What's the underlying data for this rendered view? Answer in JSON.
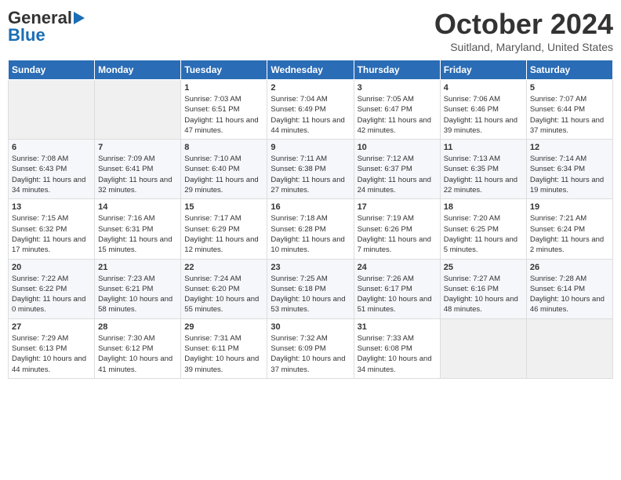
{
  "logo": {
    "line1": "General",
    "line2": "Blue"
  },
  "header": {
    "month": "October 2024",
    "location": "Suitland, Maryland, United States"
  },
  "days_of_week": [
    "Sunday",
    "Monday",
    "Tuesday",
    "Wednesday",
    "Thursday",
    "Friday",
    "Saturday"
  ],
  "weeks": [
    [
      {
        "day": "",
        "sunrise": "",
        "sunset": "",
        "daylight": ""
      },
      {
        "day": "",
        "sunrise": "",
        "sunset": "",
        "daylight": ""
      },
      {
        "day": "1",
        "sunrise": "Sunrise: 7:03 AM",
        "sunset": "Sunset: 6:51 PM",
        "daylight": "Daylight: 11 hours and 47 minutes."
      },
      {
        "day": "2",
        "sunrise": "Sunrise: 7:04 AM",
        "sunset": "Sunset: 6:49 PM",
        "daylight": "Daylight: 11 hours and 44 minutes."
      },
      {
        "day": "3",
        "sunrise": "Sunrise: 7:05 AM",
        "sunset": "Sunset: 6:47 PM",
        "daylight": "Daylight: 11 hours and 42 minutes."
      },
      {
        "day": "4",
        "sunrise": "Sunrise: 7:06 AM",
        "sunset": "Sunset: 6:46 PM",
        "daylight": "Daylight: 11 hours and 39 minutes."
      },
      {
        "day": "5",
        "sunrise": "Sunrise: 7:07 AM",
        "sunset": "Sunset: 6:44 PM",
        "daylight": "Daylight: 11 hours and 37 minutes."
      }
    ],
    [
      {
        "day": "6",
        "sunrise": "Sunrise: 7:08 AM",
        "sunset": "Sunset: 6:43 PM",
        "daylight": "Daylight: 11 hours and 34 minutes."
      },
      {
        "day": "7",
        "sunrise": "Sunrise: 7:09 AM",
        "sunset": "Sunset: 6:41 PM",
        "daylight": "Daylight: 11 hours and 32 minutes."
      },
      {
        "day": "8",
        "sunrise": "Sunrise: 7:10 AM",
        "sunset": "Sunset: 6:40 PM",
        "daylight": "Daylight: 11 hours and 29 minutes."
      },
      {
        "day": "9",
        "sunrise": "Sunrise: 7:11 AM",
        "sunset": "Sunset: 6:38 PM",
        "daylight": "Daylight: 11 hours and 27 minutes."
      },
      {
        "day": "10",
        "sunrise": "Sunrise: 7:12 AM",
        "sunset": "Sunset: 6:37 PM",
        "daylight": "Daylight: 11 hours and 24 minutes."
      },
      {
        "day": "11",
        "sunrise": "Sunrise: 7:13 AM",
        "sunset": "Sunset: 6:35 PM",
        "daylight": "Daylight: 11 hours and 22 minutes."
      },
      {
        "day": "12",
        "sunrise": "Sunrise: 7:14 AM",
        "sunset": "Sunset: 6:34 PM",
        "daylight": "Daylight: 11 hours and 19 minutes."
      }
    ],
    [
      {
        "day": "13",
        "sunrise": "Sunrise: 7:15 AM",
        "sunset": "Sunset: 6:32 PM",
        "daylight": "Daylight: 11 hours and 17 minutes."
      },
      {
        "day": "14",
        "sunrise": "Sunrise: 7:16 AM",
        "sunset": "Sunset: 6:31 PM",
        "daylight": "Daylight: 11 hours and 15 minutes."
      },
      {
        "day": "15",
        "sunrise": "Sunrise: 7:17 AM",
        "sunset": "Sunset: 6:29 PM",
        "daylight": "Daylight: 11 hours and 12 minutes."
      },
      {
        "day": "16",
        "sunrise": "Sunrise: 7:18 AM",
        "sunset": "Sunset: 6:28 PM",
        "daylight": "Daylight: 11 hours and 10 minutes."
      },
      {
        "day": "17",
        "sunrise": "Sunrise: 7:19 AM",
        "sunset": "Sunset: 6:26 PM",
        "daylight": "Daylight: 11 hours and 7 minutes."
      },
      {
        "day": "18",
        "sunrise": "Sunrise: 7:20 AM",
        "sunset": "Sunset: 6:25 PM",
        "daylight": "Daylight: 11 hours and 5 minutes."
      },
      {
        "day": "19",
        "sunrise": "Sunrise: 7:21 AM",
        "sunset": "Sunset: 6:24 PM",
        "daylight": "Daylight: 11 hours and 2 minutes."
      }
    ],
    [
      {
        "day": "20",
        "sunrise": "Sunrise: 7:22 AM",
        "sunset": "Sunset: 6:22 PM",
        "daylight": "Daylight: 11 hours and 0 minutes."
      },
      {
        "day": "21",
        "sunrise": "Sunrise: 7:23 AM",
        "sunset": "Sunset: 6:21 PM",
        "daylight": "Daylight: 10 hours and 58 minutes."
      },
      {
        "day": "22",
        "sunrise": "Sunrise: 7:24 AM",
        "sunset": "Sunset: 6:20 PM",
        "daylight": "Daylight: 10 hours and 55 minutes."
      },
      {
        "day": "23",
        "sunrise": "Sunrise: 7:25 AM",
        "sunset": "Sunset: 6:18 PM",
        "daylight": "Daylight: 10 hours and 53 minutes."
      },
      {
        "day": "24",
        "sunrise": "Sunrise: 7:26 AM",
        "sunset": "Sunset: 6:17 PM",
        "daylight": "Daylight: 10 hours and 51 minutes."
      },
      {
        "day": "25",
        "sunrise": "Sunrise: 7:27 AM",
        "sunset": "Sunset: 6:16 PM",
        "daylight": "Daylight: 10 hours and 48 minutes."
      },
      {
        "day": "26",
        "sunrise": "Sunrise: 7:28 AM",
        "sunset": "Sunset: 6:14 PM",
        "daylight": "Daylight: 10 hours and 46 minutes."
      }
    ],
    [
      {
        "day": "27",
        "sunrise": "Sunrise: 7:29 AM",
        "sunset": "Sunset: 6:13 PM",
        "daylight": "Daylight: 10 hours and 44 minutes."
      },
      {
        "day": "28",
        "sunrise": "Sunrise: 7:30 AM",
        "sunset": "Sunset: 6:12 PM",
        "daylight": "Daylight: 10 hours and 41 minutes."
      },
      {
        "day": "29",
        "sunrise": "Sunrise: 7:31 AM",
        "sunset": "Sunset: 6:11 PM",
        "daylight": "Daylight: 10 hours and 39 minutes."
      },
      {
        "day": "30",
        "sunrise": "Sunrise: 7:32 AM",
        "sunset": "Sunset: 6:09 PM",
        "daylight": "Daylight: 10 hours and 37 minutes."
      },
      {
        "day": "31",
        "sunrise": "Sunrise: 7:33 AM",
        "sunset": "Sunset: 6:08 PM",
        "daylight": "Daylight: 10 hours and 34 minutes."
      },
      {
        "day": "",
        "sunrise": "",
        "sunset": "",
        "daylight": ""
      },
      {
        "day": "",
        "sunrise": "",
        "sunset": "",
        "daylight": ""
      }
    ]
  ]
}
